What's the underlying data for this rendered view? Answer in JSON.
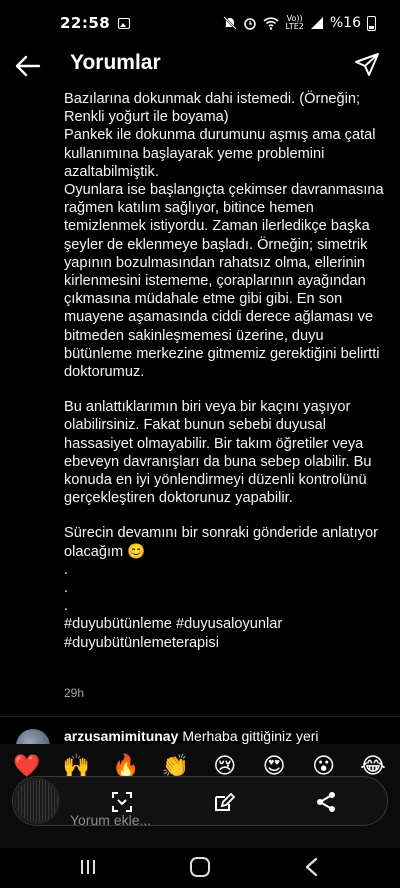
{
  "status_bar": {
    "time": "22:58",
    "network_top": "Vo))",
    "network_bottom": "LTE2",
    "battery": "%16"
  },
  "header": {
    "title": "Yorumlar"
  },
  "caption": {
    "paragraphs": [
      "Bazılarına dokunmak dahi istemedi. (Örneğin; Renkli yoğurt ile boyama)",
      "Pankek ile dokunma durumunu aşmış ama çatal kullanımına başlayarak yeme problemini azaltabilmiştik.",
      "Oyunlara ise başlangıçta çekimser davranmasına rağmen katılım sağlıyor, bitince hemen temizlenmek istiyordu. Zaman ilerledikçe başka şeyler de eklenmeye başladı. Örneğin; simetrik yapının bozulmasından rahatsız olma, ellerinin kirlenmesini istememe, çoraplarının ayağından çıkmasına müdahale etme gibi gibi. En son muayene aşamasında ciddi derece ağlaması ve bitmeden sakinleşmemesi üzerine, duyu bütünleme merkezine gitmemiz gerektiğini belirtti doktorumuz.",
      "",
      "Bu anlattıklarımın biri veya bir kaçını yaşıyor olabilirsiniz. Fakat bunun sebebi duyusal hassasiyet olmayabilir. Bir takım öğretiler veya ebeveyn davranışları da buna sebep olabilir. Bu konuda en iyi yönlendirmeyi düzenli kontrolünü gerçekleştiren doktorunuz yapabilir.",
      "",
      "Sürecin devamını bir sonraki gönderide anlatıyor olacağım 😊",
      ".",
      ".",
      ".",
      "#duyubütünleme #duyusaloyunlar #duyubütünlemeterapisi"
    ],
    "time_ago": "29h"
  },
  "next_comment": {
    "username": "arzusamimitunay",
    "text": "Merhaba gittiğiniz yeri"
  },
  "reactions": [
    "❤️",
    "🙌",
    "🔥",
    "👏",
    "😢",
    "😍",
    "😮",
    "😂"
  ],
  "composer": {
    "placeholder": "Yorum ekle..."
  },
  "icons": {
    "back": "arrow-left-icon",
    "send": "paper-plane-icon",
    "scan": "scan-icon",
    "edit": "edit-photo-icon",
    "share": "share-icon"
  }
}
